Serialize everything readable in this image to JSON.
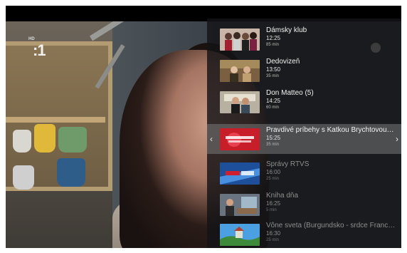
{
  "channel": {
    "logo": ":1",
    "logo_badge": "HD"
  },
  "colors": {
    "panel_bg": "#141416",
    "selected_bg": "#787878",
    "text": "#f2f2f2",
    "dim_text": "#8e8e8e"
  },
  "nav": {
    "left_arrow": "‹",
    "right_arrow": "›"
  },
  "programmes": [
    {
      "title": "Dámsky klub",
      "time": "12:25",
      "duration": "85 min",
      "thumb": "women-group"
    },
    {
      "title": "Dedovizeň",
      "time": "13:50",
      "duration": "35 min",
      "thumb": "room-scene"
    },
    {
      "title": "Don Matteo (5)",
      "time": "14:25",
      "duration": "60 min",
      "thumb": "priest-scene"
    },
    {
      "title": "Pravdivé príbehy s Katkou Brychtovou (N...",
      "time": "15:25",
      "duration": "35 min",
      "thumb": "red-title"
    },
    {
      "title": "Správy RTVS",
      "time": "16:00",
      "duration": "25 min",
      "thumb": "news-blue"
    },
    {
      "title": "Kniha dňa",
      "time": "16:25",
      "duration": "5 min",
      "thumb": "book-scene"
    },
    {
      "title": "Vône sveta (Burgundsko - srdce Francúz...",
      "time": "16:30",
      "duration": "25 min",
      "thumb": "landscape"
    }
  ]
}
